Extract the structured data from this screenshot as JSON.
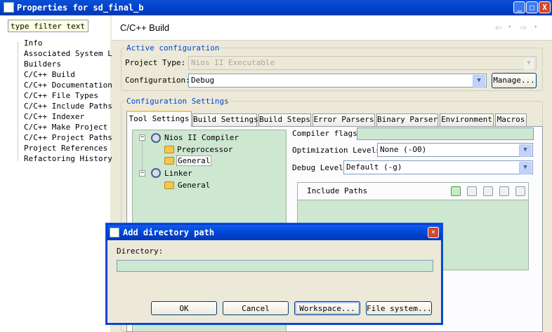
{
  "window": {
    "title": "Properties for sd_final_b",
    "minimize": "_",
    "maximize": "□",
    "close": "X"
  },
  "filter": {
    "value": "type filter text"
  },
  "nav": {
    "items": [
      "Info",
      "Associated System Li",
      "Builders",
      "C/C++ Build",
      "C/C++ Documentation",
      "C/C++ File Types",
      "C/C++ Include Paths",
      "C/C++ Indexer",
      "C/C++ Make Project",
      "C/C++ Project Paths",
      "Project References",
      "Refactoring History"
    ],
    "selected": "C/C++ Build"
  },
  "page": {
    "title": "C/C++ Build",
    "back": "⇦",
    "forward": "⇨",
    "dropdown": "▾"
  },
  "active_config": {
    "group_title": "Active configuration",
    "project_type_label": "Project Type:",
    "project_type_value": "Nios II Executable",
    "configuration_label": "Configuration:",
    "configuration_value": "Debug",
    "manage_button": "Manage..."
  },
  "config_settings": {
    "group_title": "Configuration Settings",
    "tabs": [
      "Tool Settings",
      "Build Settings",
      "Build Steps",
      "Error Parsers",
      "Binary Parser",
      "Environment",
      "Macros"
    ],
    "active_tab": "Tool Settings"
  },
  "tool_tree": {
    "compiler": "Nios II Compiler",
    "preprocessor": "Preprocessor",
    "general_compiler": "General",
    "linker": "Linker",
    "general_linker": "General",
    "expand_glyph": "−"
  },
  "settings": {
    "compiler_flags_label": "Compiler flags",
    "compiler_flags_value": "",
    "optimization_label": "Optimization Levels",
    "optimization_value": "None (-O0)",
    "debug_label": "Debug Level",
    "debug_value": "Default (-g)"
  },
  "include_paths": {
    "label": "Include Paths"
  },
  "dialog": {
    "title": "Add directory path",
    "directory_label": "Directory:",
    "directory_value": "",
    "ok": "OK",
    "cancel": "Cancel",
    "workspace": "Workspace...",
    "file_system": "File system..."
  }
}
